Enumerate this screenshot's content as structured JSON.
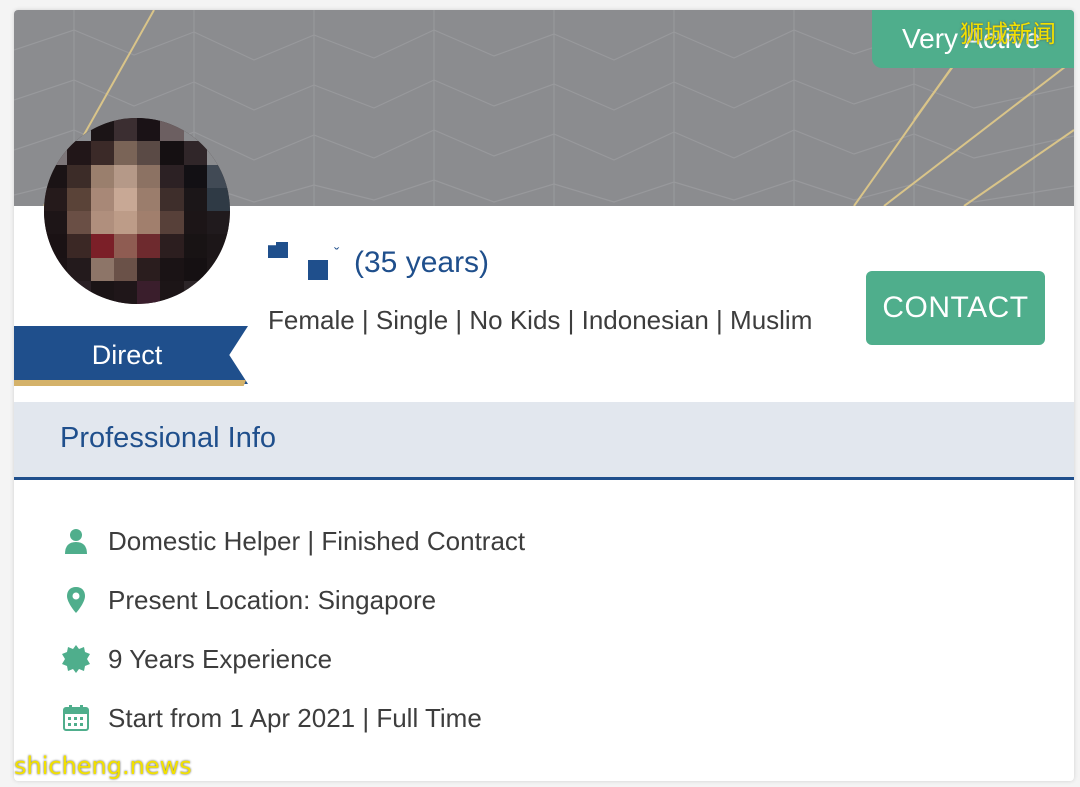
{
  "profile": {
    "activity_badge": "Very Active",
    "age_text": "(35 years)",
    "hire_type": "Direct",
    "attributes": "Female | Single | No Kids | Indonesian | Muslim",
    "contact_label": "CONTACT"
  },
  "section": {
    "title": "Professional Info"
  },
  "info_items": [
    {
      "icon": "person-icon",
      "text": "Domestic Helper | Finished Contract"
    },
    {
      "icon": "location-pin-icon",
      "text": "Present Location: Singapore"
    },
    {
      "icon": "badge-icon",
      "text": "9 Years Experience"
    },
    {
      "icon": "calendar-icon",
      "text": "Start from 1 Apr 2021 | Full Time"
    }
  ],
  "watermarks": {
    "top_right": "狮城新闻",
    "bottom_left": "shicheng.news"
  },
  "colors": {
    "accent_green": "#4fae8c",
    "brand_blue": "#1f4f8c",
    "ribbon_gold": "#d4b26a",
    "section_bg": "#e2e7ee"
  }
}
